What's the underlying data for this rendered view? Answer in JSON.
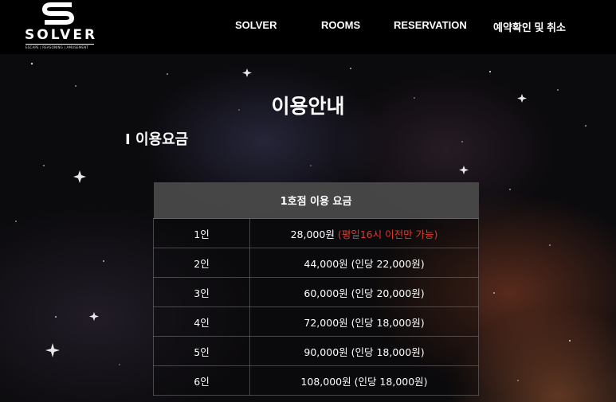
{
  "brand": {
    "name": "SOLVER",
    "tagline": "ESCAPE | REASONING | AMUSEMENT"
  },
  "nav": {
    "items": [
      "SOLVER",
      "ROOMS",
      "RESERVATION",
      "예약확인 및 취소"
    ]
  },
  "main": {
    "page_title": "이용안내",
    "section_title": "I 이용요금",
    "table": {
      "header": "1호점 이용 요금",
      "rows": [
        {
          "people": "1인",
          "price": "28,000원",
          "note": "(평일16시 이전만 가능)"
        },
        {
          "people": "2인",
          "price": "44,000원 (인당 22,000원)",
          "note": ""
        },
        {
          "people": "3인",
          "price": "60,000원 (인당 20,000원)",
          "note": ""
        },
        {
          "people": "4인",
          "price": "72,000원 (인당 18,000원)",
          "note": ""
        },
        {
          "people": "5인",
          "price": "90,000원 (인당 18,000원)",
          "note": ""
        },
        {
          "people": "6인",
          "price": "108,000원 (인당 18,000원)",
          "note": ""
        }
      ]
    }
  },
  "colors": {
    "header_bg": "#000000",
    "table_header_bg": "#4b4b4b",
    "note_red": "#e03a2e"
  }
}
